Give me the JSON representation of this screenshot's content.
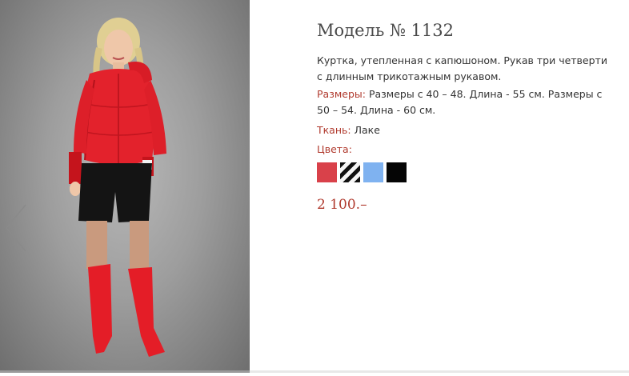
{
  "product": {
    "title": "Модель № 1132",
    "description": "Куртка, утепленная с капюшоном. Рукав три четверти с длинным трикотажным рукавом.",
    "sizes_label": "Размеры:",
    "sizes_value": " Размеры с 40 – 48. Длина - 55 см. Размеры с 50 – 54. Длина - 60 см.",
    "fabric_label": "Ткань:",
    "fabric_value": " Лаке",
    "colors_label": "Цвета:",
    "price": "2 100.–"
  },
  "swatches": [
    {
      "name": "red",
      "color": "#d9414a"
    },
    {
      "name": "black-white-stripes",
      "color": "#222222"
    },
    {
      "name": "light-blue",
      "color": "#7fb2f0"
    },
    {
      "name": "black",
      "color": "#050505"
    }
  ],
  "gallery": {
    "prev_icon": "chevron-left-icon"
  },
  "colors": {
    "accent": "#b03a2e",
    "text": "#333333",
    "title": "#4a4a4a"
  }
}
